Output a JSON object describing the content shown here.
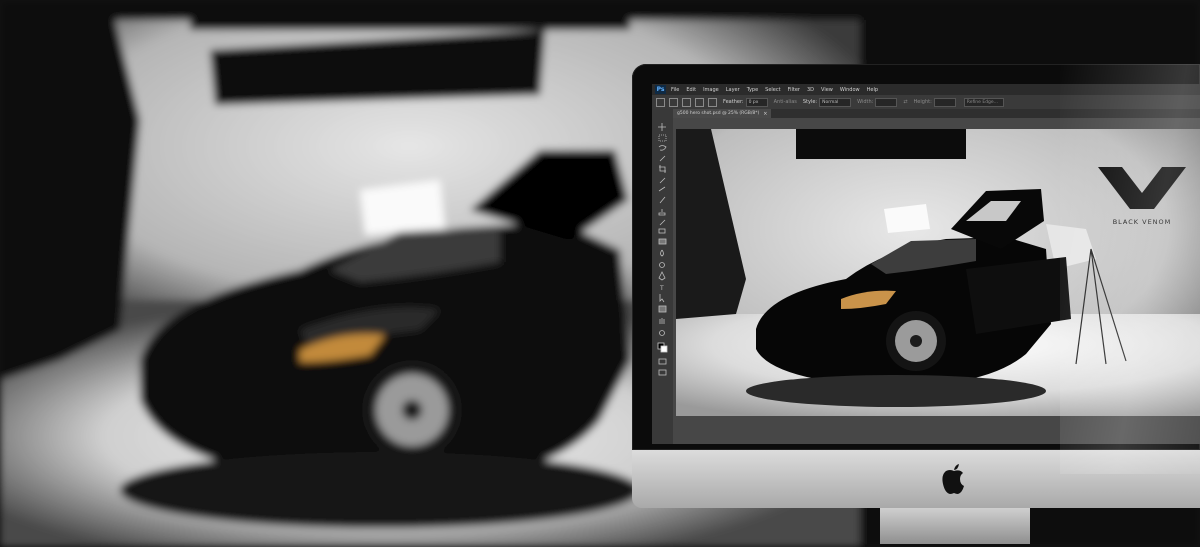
{
  "photoshop": {
    "logo": "Ps",
    "menu": [
      "File",
      "Edit",
      "Image",
      "Layer",
      "Type",
      "Select",
      "Filter",
      "3D",
      "View",
      "Window",
      "Help"
    ],
    "options": {
      "feather_label": "Feather:",
      "feather_value": "0 px",
      "anti_alias_label": "Anti-alias",
      "style_label": "Style:",
      "style_value": "Normal",
      "width_label": "Width:",
      "height_label": "Height:",
      "refine_edge_label": "Refine Edge..."
    },
    "document_tab": "g500 hero shot.psd @ 25% (RGB/8*)",
    "tools": [
      "move-icon",
      "marquee-icon",
      "lasso-icon",
      "quick-select-icon",
      "crop-icon",
      "eyedropper-icon",
      "healing-icon",
      "brush-icon",
      "stamp-icon",
      "history-brush-icon",
      "eraser-icon",
      "gradient-icon",
      "blur-icon",
      "dodge-icon",
      "pen-icon",
      "type-icon",
      "path-select-icon",
      "shape-icon",
      "hand-icon",
      "zoom-icon"
    ]
  },
  "brand": {
    "text": "BLACK VENOM",
    "logo_icon": "black-venom-v-logo-icon"
  },
  "colors": {
    "bezel": "#0b0b0b",
    "chin": "#c8c8c8",
    "ps_menubar": "#2b2b2b",
    "ps_panel": "#393939",
    "ps_accent": "#5fb0ff"
  },
  "device_icon": "apple-logo-icon"
}
